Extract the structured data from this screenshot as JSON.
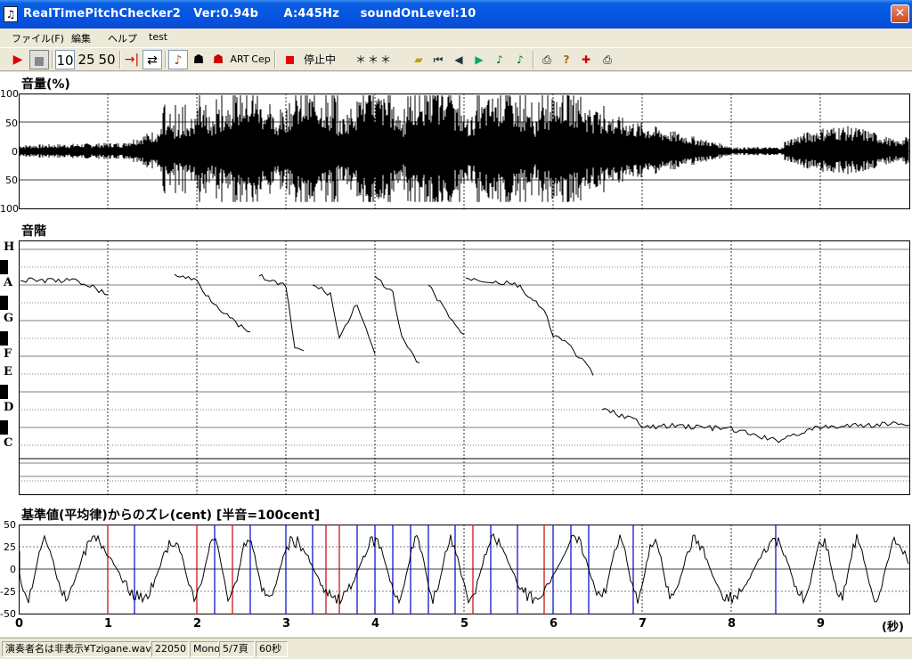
{
  "titlebar": {
    "title": "RealTimePitchChecker2   Ver:0.94b      A:445Hz     soundOnLevel:10",
    "icon": "tuning-fork-icon",
    "close_label": "✕"
  },
  "menu": {
    "items": [
      "ファイル(F)",
      "編集",
      "ヘルプ",
      "test"
    ]
  },
  "toolbar": {
    "btn_10": "10",
    "btn_25": "25",
    "btn_50": "50",
    "art_label": "ART",
    "cep_label": "Cep",
    "status_text": "停止中",
    "stars": "＊＊＊"
  },
  "volume_panel": {
    "title": "音量(%)",
    "yticks": [
      "100",
      "50",
      "0",
      "50",
      "100"
    ]
  },
  "scale_panel": {
    "title": "音階",
    "notes": [
      "H",
      "A",
      "G",
      "F",
      "E",
      "D",
      "C"
    ]
  },
  "cent_panel": {
    "title": "基準値(平均律)からのズレ(cent) [半音=100cent]",
    "yticks": [
      "50",
      "25",
      "0",
      "-25",
      "-50"
    ]
  },
  "time_axis": {
    "ticks": [
      "0",
      "1",
      "2",
      "3",
      "4",
      "5",
      "6",
      "7",
      "8",
      "9"
    ],
    "unit": "(秒)"
  },
  "statusbar": {
    "performer": "演奏者名は非表示¥Tzigane.wav",
    "sample_rate": "22050",
    "channel": "Mono",
    "page": "5/7頁",
    "duration": "60秒"
  }
}
